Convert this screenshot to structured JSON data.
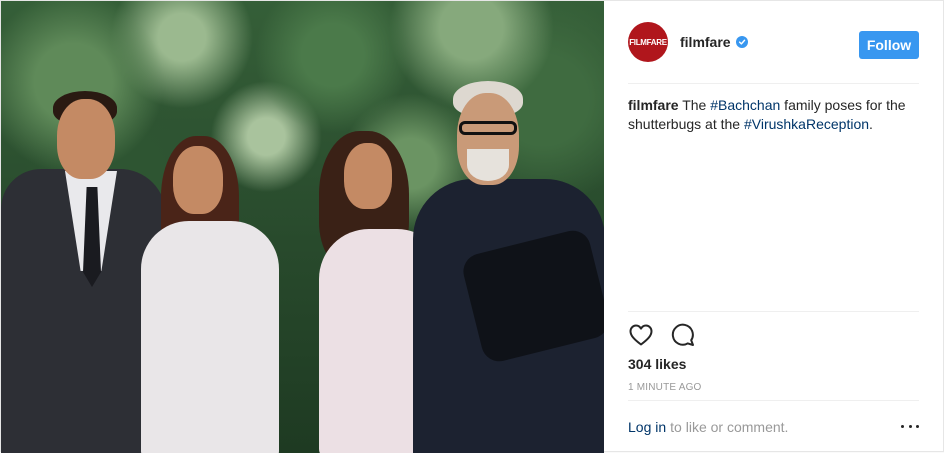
{
  "post": {
    "photo_label": "photo",
    "account": {
      "avatar_text": "FILMFARE",
      "username": "filmfare",
      "verified": true,
      "follow_label": "Follow",
      "brand_color": "#b0161c",
      "accent_color": "#3897f0"
    },
    "caption": {
      "username": "filmfare",
      "parts": {
        "text_1": " The ",
        "tag_1": "#Bachchan",
        "text_2": " family poses for the shutterbugs at the ",
        "tag_2": "#VirushkaReception",
        "text_3": "."
      }
    },
    "actions": {
      "like_icon": "heart-icon",
      "comment_icon": "comment-icon"
    },
    "likes": "304 likes",
    "timestamp": "1 minute ago",
    "comment_bar": {
      "login_label": "Log in",
      "prompt": "to like or comment.",
      "more_icon": "ellipsis-icon"
    }
  }
}
